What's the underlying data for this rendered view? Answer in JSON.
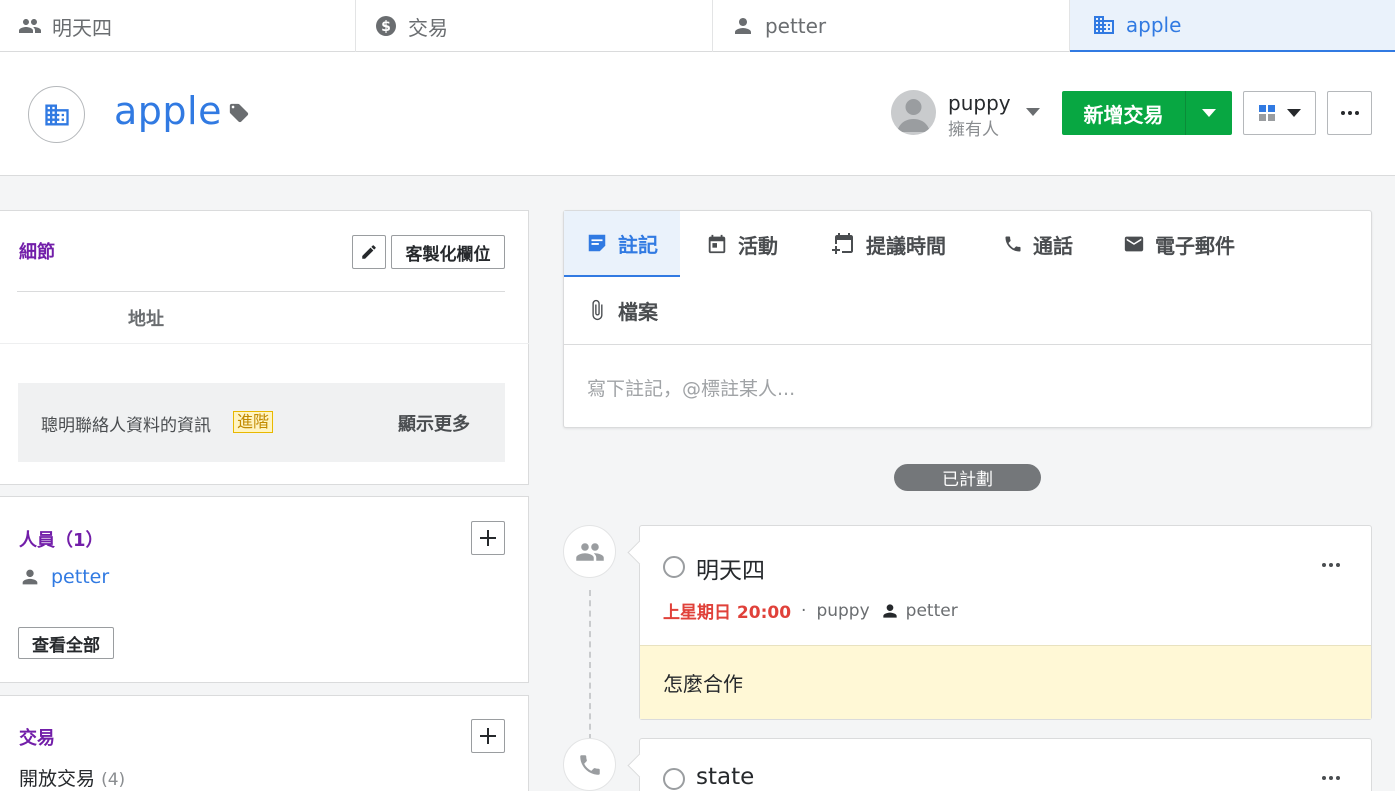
{
  "tabs": [
    {
      "label": "明天四",
      "icon": "people-icon"
    },
    {
      "label": "交易",
      "icon": "dollar-icon"
    },
    {
      "label": "petter",
      "icon": "person-icon"
    },
    {
      "label": "apple",
      "icon": "building-icon",
      "active": true
    }
  ],
  "header": {
    "title": "apple",
    "owner_name": "puppy",
    "owner_role": "擁有人",
    "new_deal_label": "新增交易"
  },
  "details": {
    "title": "細節",
    "customize_label": "客製化欄位",
    "address_label": "地址",
    "smart_text": "聰明聯絡人資料的資訊",
    "smart_badge": "進階",
    "show_more": "顯示更多"
  },
  "people": {
    "title": "人員（1）",
    "items": [
      {
        "name": "petter"
      }
    ],
    "view_all": "查看全部"
  },
  "deals": {
    "title": "交易",
    "open_label": "開放交易",
    "open_count": "(4)"
  },
  "composer": {
    "tabs": [
      {
        "label": "註記",
        "icon": "note-icon",
        "active": true
      },
      {
        "label": "活動",
        "icon": "calendar-icon"
      },
      {
        "label": "提議時間",
        "icon": "calendar-plus-icon"
      },
      {
        "label": "通話",
        "icon": "phone-icon"
      },
      {
        "label": "電子郵件",
        "icon": "mail-icon"
      },
      {
        "label": "檔案",
        "icon": "paperclip-icon"
      }
    ],
    "placeholder": "寫下註記，@標註某人..."
  },
  "timeline": {
    "planned_label": "已計劃",
    "activities": [
      {
        "title": "明天四",
        "when": "上星期日 20:00",
        "owner": "puppy",
        "person": "petter",
        "note": "怎麼合作",
        "icon": "meeting-icon"
      },
      {
        "title": "state",
        "icon": "phone-icon"
      }
    ]
  },
  "colors": {
    "accent": "#317ae2",
    "primary_button": "#08a742",
    "section_title": "#721ea9",
    "overdue": "#e0413a",
    "note_bg": "#fff8d6"
  }
}
